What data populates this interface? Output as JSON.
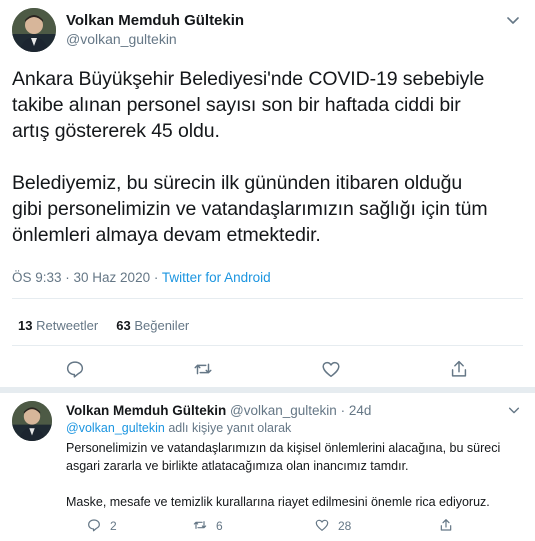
{
  "main_tweet": {
    "author_name": "Volkan Memduh Gültekin",
    "author_handle": "@volkan_gultekin",
    "text": "Ankara Büyükşehir Belediyesi'nde COVID-19 sebebiyle\ntakibe alınan personel sayısı son bir haftada ciddi bir\nartış göstererek 45 oldu.\n\nBelediyemiz, bu sürecin ilk gününden itibaren olduğu\ngibi personelimizin ve vatandaşlarımızın sağlığı için tüm\nönlemleri almaya devam etmektedir.",
    "timestamp": "ÖS 9:33 · 30 Haz 2020 · ",
    "source": "Twitter for Android",
    "retweets_count": "13",
    "retweets_label": "Retweetler",
    "likes_count": "63",
    "likes_label": "Beğeniler"
  },
  "reply": {
    "author_name": "Volkan Memduh Gültekin",
    "author_handle": "@volkan_gultekin",
    "time": "24d",
    "reply_to_mention": "@volkan_gultekin",
    "reply_to_suffix": " adlı kişiye yanıt olarak",
    "text": "Personelimizin ve vatandaşlarımızın da kişisel önlemlerini alacağına, bu süreci\nasgari zararla ve birlikte atlatacağımıza olan inancımız tamdır.\n\nMaske, mesafe ve temizlik kurallarına riayet edilmesini önemle rica ediyoruz.",
    "reply_count": "2",
    "retweet_count": "6",
    "like_count": "28"
  },
  "icons": {
    "reply": "reply-icon",
    "retweet": "retweet-icon",
    "like": "heart-icon",
    "share": "share-icon",
    "more": "chevron-down-icon"
  },
  "colors": {
    "text": "#14171a",
    "secondary": "#657786",
    "link": "#1b95e0",
    "divider": "#e6ecf0"
  }
}
